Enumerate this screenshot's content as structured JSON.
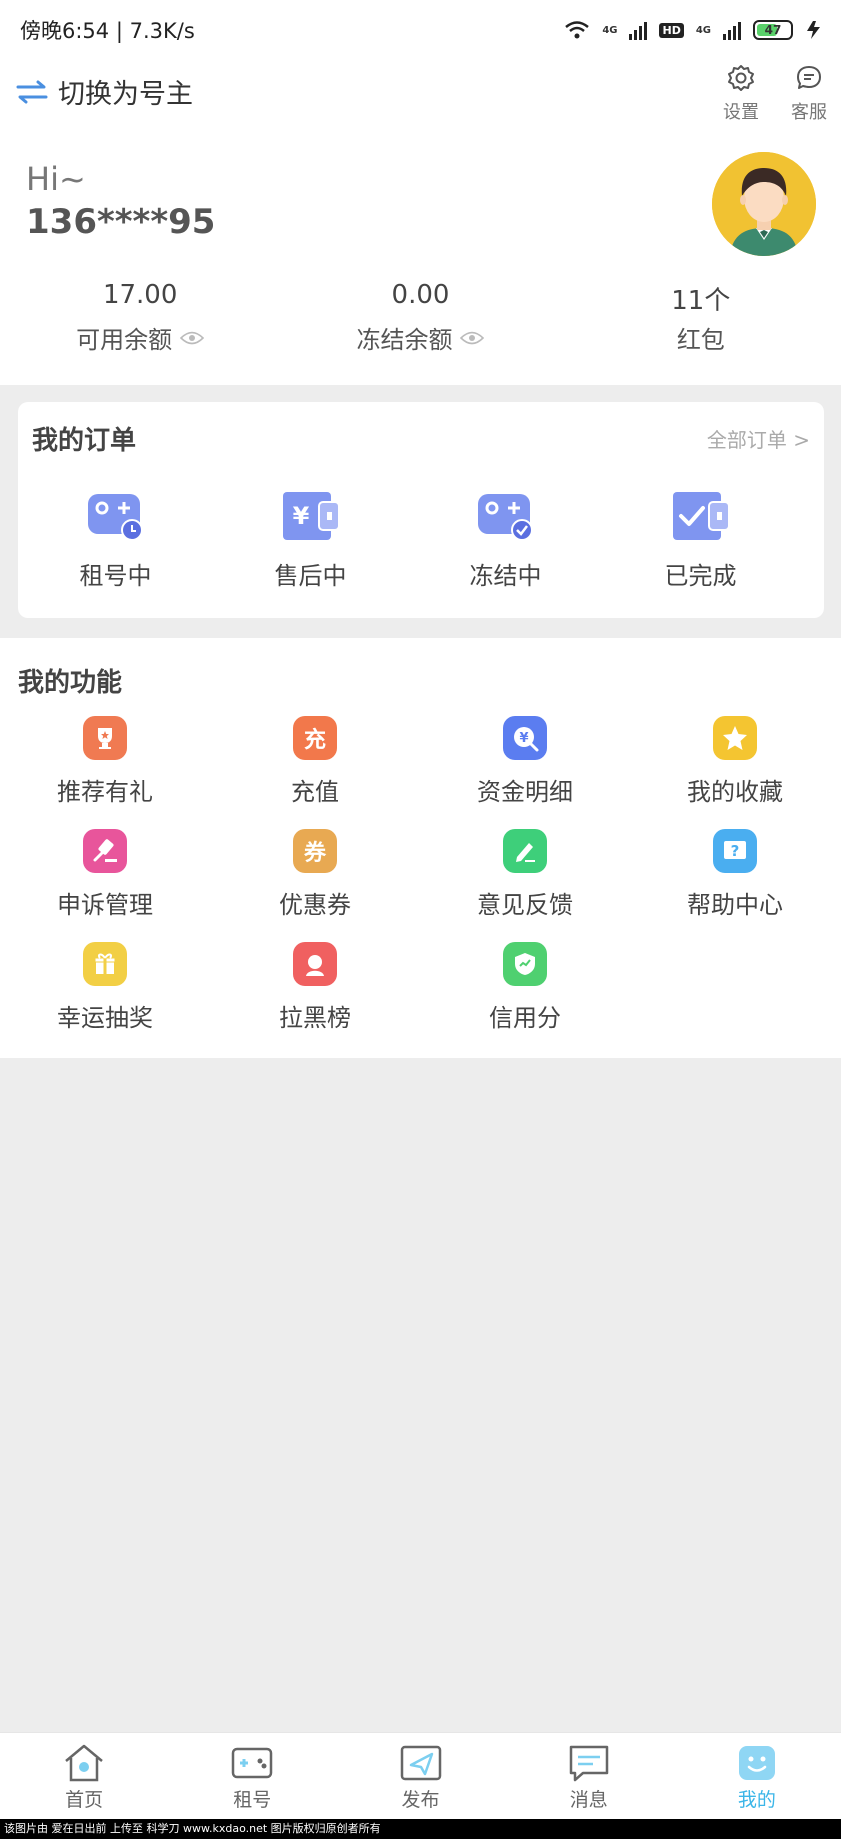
{
  "status_bar": {
    "time": "傍晚6:54 | 7.3K/s",
    "network_1": "4G",
    "hd": "HD",
    "network_2": "4G",
    "battery": "47"
  },
  "header": {
    "switch_label": "切换为号主",
    "settings_label": "设置",
    "service_label": "客服",
    "greeting": "Hi~",
    "phone": "136****95"
  },
  "stats": [
    {
      "value": "17.00",
      "label": "可用余额"
    },
    {
      "value": "0.00",
      "label": "冻结余额"
    },
    {
      "value": "11个",
      "label": "红包"
    }
  ],
  "orders": {
    "title": "我的订单",
    "all_label": "全部订单 >",
    "items": [
      {
        "label": "租号中",
        "icon": "gamepad-clock-icon"
      },
      {
        "label": "售后中",
        "icon": "wallet-yen-icon"
      },
      {
        "label": "冻结中",
        "icon": "gamepad-check-icon"
      },
      {
        "label": "已完成",
        "icon": "wallet-check-icon"
      }
    ]
  },
  "functions": {
    "title": "我的功能",
    "items": [
      {
        "label": "推荐有礼",
        "icon": "trophy-icon",
        "color": "#f07a52"
      },
      {
        "label": "充值",
        "icon": "recharge-icon",
        "glyph": "充",
        "color": "#f2784b"
      },
      {
        "label": "资金明细",
        "icon": "fund-detail-icon",
        "color": "#5b7df0"
      },
      {
        "label": "我的收藏",
        "icon": "star-icon",
        "color": "#f4c531"
      },
      {
        "label": "申诉管理",
        "icon": "gavel-icon",
        "color": "#e8559b"
      },
      {
        "label": "优惠券",
        "icon": "coupon-icon",
        "glyph": "券",
        "color": "#e8a952"
      },
      {
        "label": "意见反馈",
        "icon": "pencil-icon",
        "color": "#3ecf7a"
      },
      {
        "label": "帮助中心",
        "icon": "help-icon",
        "color": "#4aaef0"
      },
      {
        "label": "幸运抽奖",
        "icon": "gift-icon",
        "color": "#f2cf45"
      },
      {
        "label": "拉黑榜",
        "icon": "blacklist-icon",
        "color": "#f06060"
      },
      {
        "label": "信用分",
        "icon": "shield-icon",
        "color": "#4fd070"
      }
    ]
  },
  "bottom_nav": [
    {
      "label": "首页",
      "icon": "home-icon",
      "active": false
    },
    {
      "label": "租号",
      "icon": "gamepad-icon",
      "active": false
    },
    {
      "label": "发布",
      "icon": "send-icon",
      "active": false
    },
    {
      "label": "消息",
      "icon": "message-icon",
      "active": false
    },
    {
      "label": "我的",
      "icon": "profile-icon",
      "active": true
    }
  ],
  "footer_note": "该图片由 爱在日出前 上传至 科学刀 www.kxdao.net 图片版权归原创者所有",
  "colors": {
    "accent": "#3bb6e8",
    "order_icon_gradient": [
      "#8ea6f5",
      "#6f84ee"
    ]
  }
}
